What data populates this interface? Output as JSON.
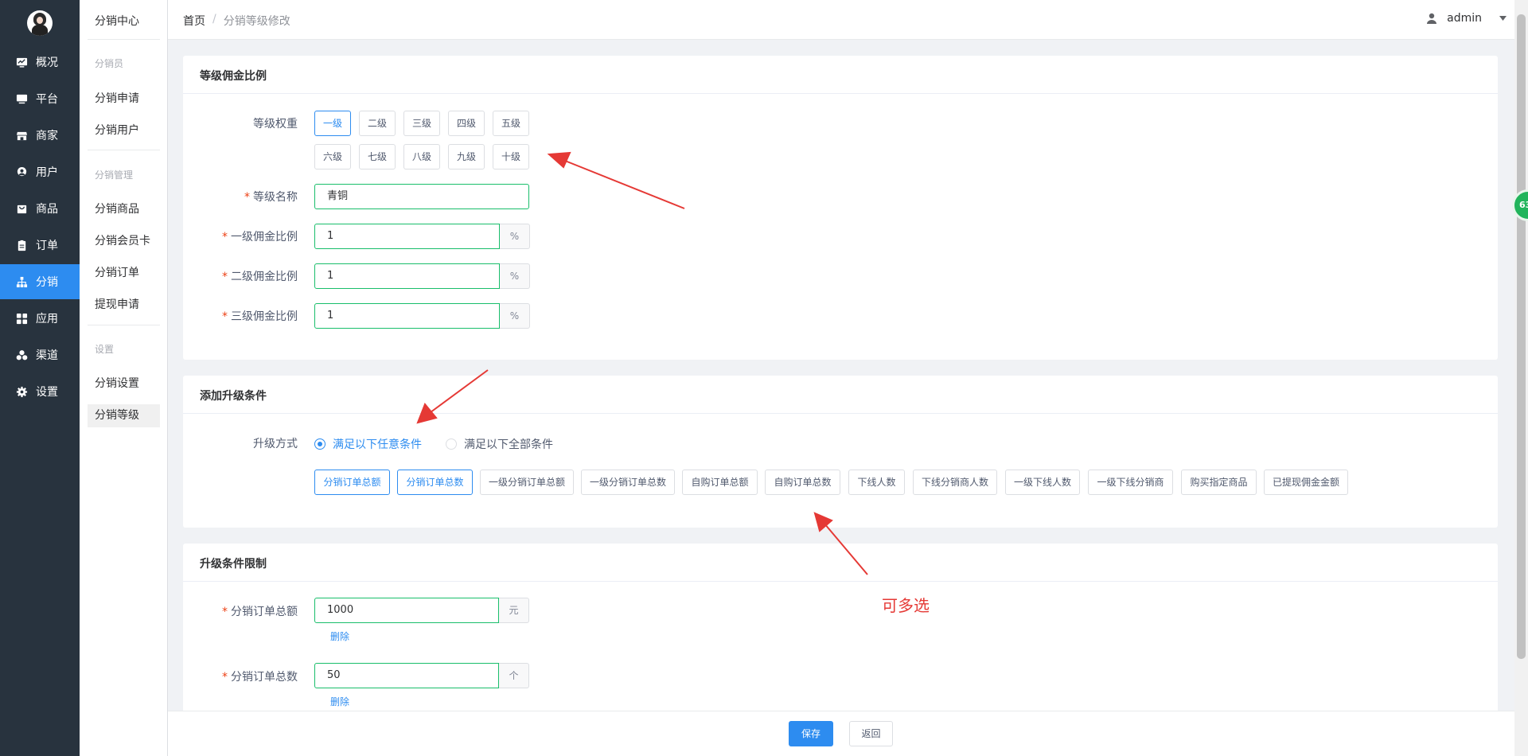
{
  "sidebar": {
    "items": [
      {
        "label": "概况",
        "icon": "monitor-chart-icon"
      },
      {
        "label": "平台",
        "icon": "desktop-icon"
      },
      {
        "label": "商家",
        "icon": "store-icon"
      },
      {
        "label": "用户",
        "icon": "user-icon"
      },
      {
        "label": "商品",
        "icon": "bag-icon"
      },
      {
        "label": "订单",
        "icon": "clipboard-icon"
      },
      {
        "label": "分销",
        "icon": "sitemap-icon",
        "active": true
      },
      {
        "label": "应用",
        "icon": "grid-icon"
      },
      {
        "label": "渠道",
        "icon": "cubes-icon"
      },
      {
        "label": "设置",
        "icon": "gear-icon"
      }
    ]
  },
  "subnav": {
    "title": "分销中心",
    "groups": [
      {
        "label": "分销员",
        "items": [
          "分销申请",
          "分销用户"
        ]
      },
      {
        "label": "分销管理",
        "items": [
          "分销商品",
          "分销会员卡",
          "分销订单",
          "提现申请"
        ]
      },
      {
        "label": "设置",
        "items": [
          "分销设置",
          "分销等级"
        ]
      }
    ],
    "active": "分销等级"
  },
  "header": {
    "breadcrumb": {
      "home": "首页",
      "separator": "/",
      "current": "分销等级修改"
    },
    "user": "admin"
  },
  "badge": "63",
  "commission_card": {
    "title": "等级佣金比例",
    "weight_label": "等级权重",
    "grades": [
      "一级",
      "二级",
      "三级",
      "四级",
      "五级",
      "六级",
      "七级",
      "八级",
      "九级",
      "十级"
    ],
    "selected_grade": "一级",
    "name_label": "等级名称",
    "name_value": "青铜",
    "rates": [
      {
        "label": "一级佣金比例",
        "value": "1",
        "unit": "%"
      },
      {
        "label": "二级佣金比例",
        "value": "1",
        "unit": "%"
      },
      {
        "label": "三级佣金比例",
        "value": "1",
        "unit": "%"
      }
    ]
  },
  "upgrade_card": {
    "title": "添加升级条件",
    "method_label": "升级方式",
    "options": [
      "满足以下任意条件",
      "满足以下全部条件"
    ],
    "selected_option": "满足以下任意条件",
    "conditions": [
      "分销订单总额",
      "分销订单总数",
      "一级分销订单总额",
      "一级分销订单总数",
      "自购订单总额",
      "自购订单总数",
      "下线人数",
      "下线分销商人数",
      "一级下线人数",
      "一级下线分销商",
      "购买指定商品",
      "已提现佣金金额"
    ],
    "selected_conditions": [
      "分销订单总额",
      "分销订单总数"
    ]
  },
  "limit_card": {
    "title": "升级条件限制",
    "rows": [
      {
        "label": "分销订单总额",
        "value": "1000",
        "unit": "元",
        "delete": "删除"
      },
      {
        "label": "分销订单总数",
        "value": "50",
        "unit": "个",
        "delete": "删除"
      }
    ]
  },
  "footer": {
    "save": "保存",
    "back": "返回"
  },
  "annotation": {
    "text": "可多选",
    "color": "#e53935"
  },
  "colors": {
    "primary": "#2d8cf0",
    "sidebar": "#28333e",
    "success_border": "#19be6b",
    "required": "#ed4014"
  }
}
